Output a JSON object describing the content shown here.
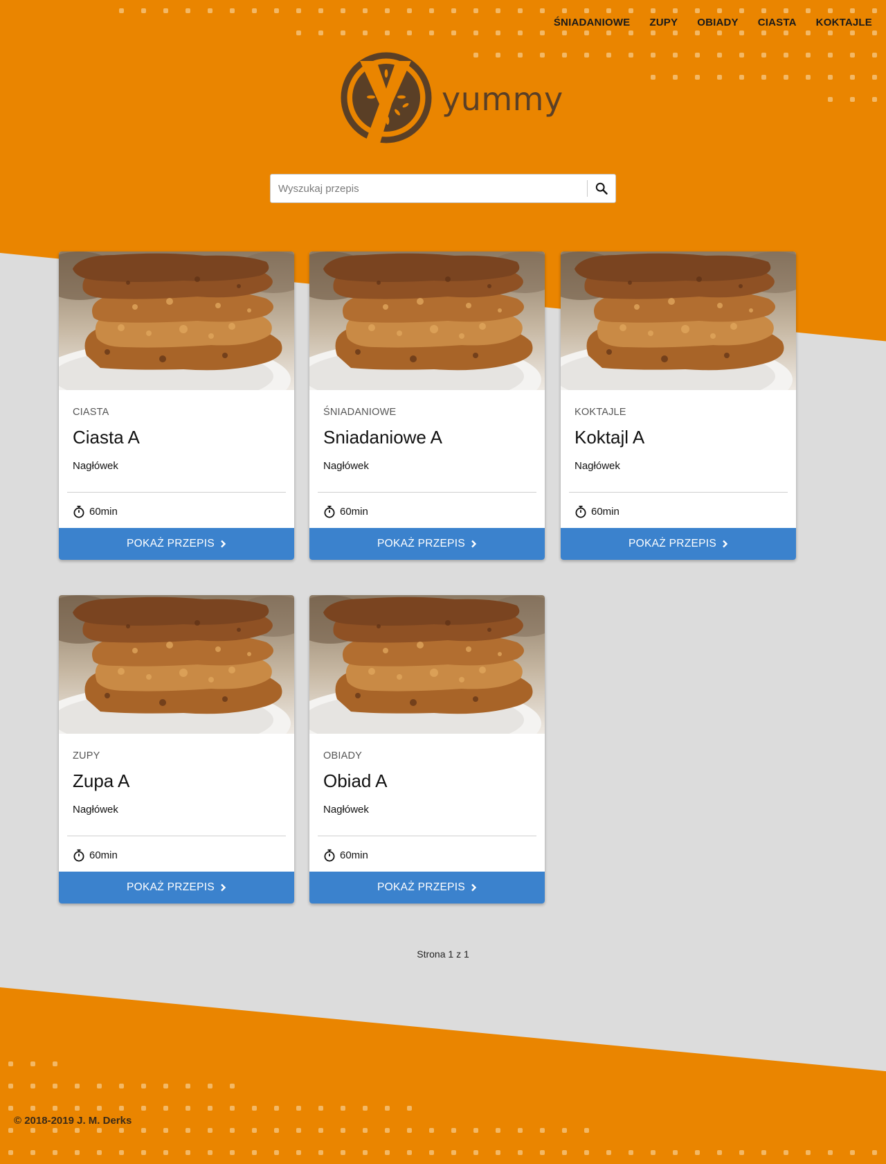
{
  "brand": {
    "name": "yummy",
    "accent": "#ea8500",
    "logo_color": "#5a3f26"
  },
  "nav": {
    "items": [
      {
        "label": "ŚNIADANIOWE",
        "name": "nav-sniadaniowe"
      },
      {
        "label": "ZUPY",
        "name": "nav-zupy"
      },
      {
        "label": "OBIADY",
        "name": "nav-obiady"
      },
      {
        "label": "CIASTA",
        "name": "nav-ciasta"
      },
      {
        "label": "KOKTAJLE",
        "name": "nav-koktajle"
      }
    ]
  },
  "search": {
    "placeholder": "Wyszukaj przepis",
    "value": "",
    "icon": "search-icon"
  },
  "recipes": [
    {
      "category": "CIASTA",
      "title": "Ciasta A",
      "subtitle": "Nagłówek",
      "time": "60min",
      "button": "POKAŻ PRZEPIS"
    },
    {
      "category": "ŚNIADANIOWE",
      "title": "Sniadaniowe A",
      "subtitle": "Nagłówek",
      "time": "60min",
      "button": "POKAŻ PRZEPIS"
    },
    {
      "category": "KOKTAJLE",
      "title": "Koktajl A",
      "subtitle": "Nagłówek",
      "time": "60min",
      "button": "POKAŻ PRZEPIS"
    },
    {
      "category": "ZUPY",
      "title": "Zupa A",
      "subtitle": "Nagłówek",
      "time": "60min",
      "button": "POKAŻ PRZEPIS"
    },
    {
      "category": "OBIADY",
      "title": "Obiad A",
      "subtitle": "Nagłówek",
      "time": "60min",
      "button": "POKAŻ PRZEPIS"
    }
  ],
  "pagination": {
    "text": "Strona 1 z 1"
  },
  "footer": {
    "copyright": "© 2018-2019 J. M. Derks"
  },
  "colors": {
    "button": "#3b82cd",
    "page_bg": "#dcdcdc"
  }
}
